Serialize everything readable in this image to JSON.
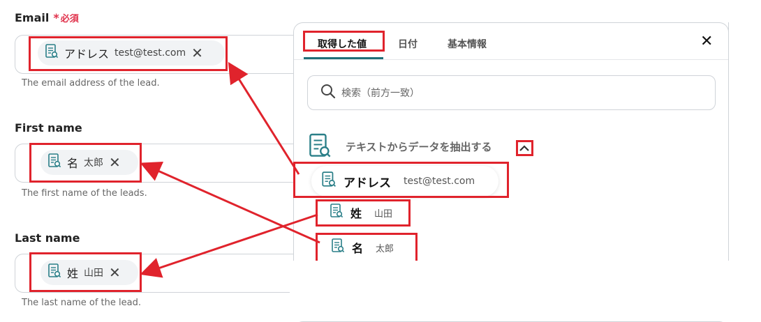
{
  "form": {
    "email": {
      "label": "Email",
      "required_star": "*",
      "required_text": "必須",
      "chip": {
        "name": "アドレス",
        "value": "test@test.com",
        "remove": "✕"
      },
      "hint": "The email address of the lead."
    },
    "first_name": {
      "label": "First name",
      "chip": {
        "name": "名",
        "value": "太郎",
        "remove": "✕"
      },
      "hint": "The first name of the leads."
    },
    "last_name": {
      "label": "Last name",
      "chip": {
        "name": "姓",
        "value": "山田",
        "remove": "✕"
      },
      "hint": "The last name of the lead."
    }
  },
  "panel": {
    "tabs": [
      {
        "label": "取得した値",
        "active": true
      },
      {
        "label": "日付"
      },
      {
        "label": "基本情報"
      }
    ],
    "close": "✕",
    "search": {
      "placeholder": "検索（前方一致）"
    },
    "section": {
      "title": "テキストからデータを抽出する",
      "chevron": "^"
    },
    "items": [
      {
        "name": "アドレス",
        "value": "test@test.com"
      },
      {
        "name": "姓",
        "value": "山田"
      },
      {
        "name": "名",
        "value": "太郎"
      }
    ]
  },
  "colors": {
    "accent": "#1f6f78",
    "annotation_red": "#e0232c",
    "required": "#e0314b",
    "icon": "#2a7f88"
  },
  "icons": [
    "document-search-icon",
    "close-icon",
    "search-icon",
    "chevron-up-icon"
  ]
}
